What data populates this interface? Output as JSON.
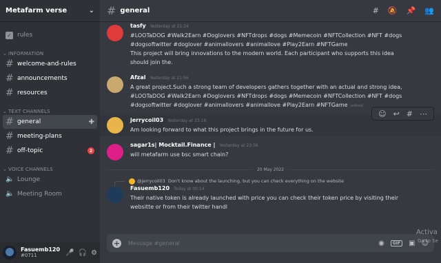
{
  "server": {
    "name": "Metafarm verse"
  },
  "rules_label": "rules",
  "categories": [
    {
      "label": "INFORMATION",
      "channels": [
        {
          "label": "welcome-and-rules"
        },
        {
          "label": "announcements"
        },
        {
          "label": "resources"
        }
      ]
    },
    {
      "label": "TEXT CHANNELS",
      "channels": [
        {
          "label": "general"
        },
        {
          "label": "meeting-plans"
        },
        {
          "label": "off-topic",
          "badge": "2"
        }
      ]
    },
    {
      "label": "VOICE CHANNELS",
      "channels": [
        {
          "label": "Lounge"
        },
        {
          "label": "Meeting Room"
        }
      ]
    }
  ],
  "user": {
    "name": "Fasuemb120",
    "tag": "#0711"
  },
  "header": {
    "channel": "general"
  },
  "messages": [
    {
      "author": "tasfy",
      "time": "Yesterday at 21:24",
      "lines": [
        "#LOOTaDOG #Walk2Earn #Doglovers #NFTdrops #dogs #Memecoin #NFTCollection #NFT #dogs",
        "#dogsoftwitter #doglover #animallovers #animallove #Play2Earn #NFTGame",
        "This project will bring innovations to the modern world. Each participant who supports this idea",
        "should join the."
      ]
    },
    {
      "author": "Afzal",
      "time": "Yesterday at 21:56",
      "lines": [
        "A great project.Such a strong team of developers gathers together with an actual and strong idea,",
        "#LOOTaDOG #Walk2Earn #Doglovers #NFTdrops #dogs #Memecoin #NFTCollection #NFT #dogs",
        "#dogsoftwitter #doglover #animallovers #animallove #Play2Earn #NFTGame"
      ],
      "edited": "(edited)"
    },
    {
      "author": "jerrycoil03",
      "time": "Yesterday at 23:16",
      "lines": [
        "Am looking forward to what this project brings in the future for us."
      ]
    },
    {
      "author": "sagar1s| Mocktail.Finance |",
      "time": "Yesterday at 23:36",
      "lines": [
        "will metafarm use bsc smart chain?"
      ]
    },
    {
      "author": "Fasuemb120",
      "time": "Today at 00:14",
      "lines": [
        "Their native token is already launched with price you can check their token price by visiting their",
        "websitte or from  their twitter handl"
      ]
    }
  ],
  "date_divider": "20 May 2022",
  "reply": {
    "author": "@jerrycoil03",
    "text": "Don't know about the launching, but you can check everything on the website"
  },
  "composer": {
    "placeholder": "Message #general",
    "gif": "GIF"
  },
  "watermark": {
    "line1": "Activa",
    "line2": "Go to Se"
  },
  "colors": {
    "background": "#36393f",
    "sidebar": "#2f3136",
    "userbar": "#292b2f",
    "badge": "#ed4245",
    "tasfy_avatar": "#e03b3b",
    "sagar_avatar": "#e01e88"
  },
  "icons": {
    "sidebar": [
      "rules-icon",
      "hash-icon",
      "add-member-icon",
      "speaker-icon",
      "mute-icon",
      "headphones-icon",
      "gear-icon"
    ],
    "header": [
      "threads-icon",
      "mute-bell-icon",
      "pin-icon",
      "members-icon"
    ],
    "toolbar": [
      "add-reaction-icon",
      "reply-icon",
      "thread-icon",
      "more-icon"
    ],
    "composer": [
      "plus-icon",
      "nitro-icon",
      "gif-icon",
      "sticker-icon",
      "emoji-icon"
    ]
  }
}
